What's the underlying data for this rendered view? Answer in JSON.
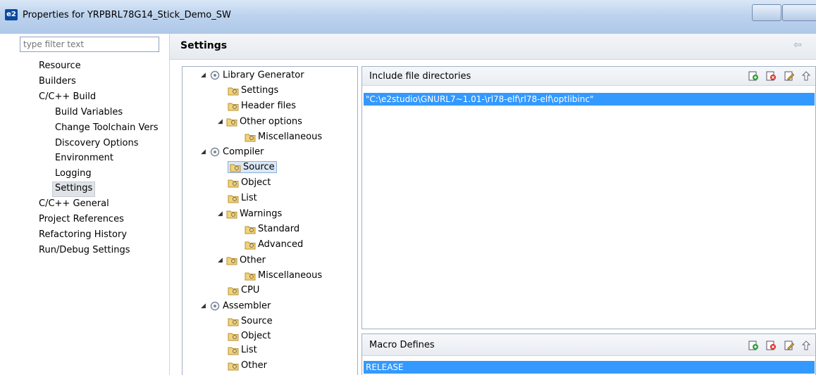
{
  "window": {
    "title": "Properties for YRPBRL78G14_Stick_Demo_SW",
    "app_icon": "e2"
  },
  "filter": {
    "placeholder": "type filter text"
  },
  "nav": {
    "items": [
      {
        "label": "Resource"
      },
      {
        "label": "Builders"
      },
      {
        "label": "C/C++ Build"
      },
      {
        "label": "Build Variables"
      },
      {
        "label": "Change Toolchain Vers"
      },
      {
        "label": "Discovery Options"
      },
      {
        "label": "Environment"
      },
      {
        "label": "Logging"
      },
      {
        "label": "Settings"
      },
      {
        "label": "C/C++ General"
      },
      {
        "label": "Project References"
      },
      {
        "label": "Refactoring History"
      },
      {
        "label": "Run/Debug Settings"
      }
    ],
    "selected": "Settings"
  },
  "header": {
    "title": "Settings",
    "back_icon": "back-arrow-icon"
  },
  "tree": {
    "items": [
      {
        "label": "Library Generator",
        "icon": "tool-icon"
      },
      {
        "label": "Settings",
        "icon": "folder-settings-icon"
      },
      {
        "label": "Header files",
        "icon": "folder-settings-icon"
      },
      {
        "label": "Other options",
        "icon": "folder-settings-icon"
      },
      {
        "label": "Miscellaneous",
        "icon": "folder-settings-icon"
      },
      {
        "label": "Compiler",
        "icon": "tool-icon"
      },
      {
        "label": "Source",
        "icon": "folder-settings-icon"
      },
      {
        "label": "Object",
        "icon": "folder-settings-icon"
      },
      {
        "label": "List",
        "icon": "folder-settings-icon"
      },
      {
        "label": "Warnings",
        "icon": "folder-settings-icon"
      },
      {
        "label": "Standard",
        "icon": "folder-settings-icon"
      },
      {
        "label": "Advanced",
        "icon": "folder-settings-icon"
      },
      {
        "label": "Other",
        "icon": "folder-settings-icon"
      },
      {
        "label": "Miscellaneous",
        "icon": "folder-settings-icon"
      },
      {
        "label": "CPU",
        "icon": "folder-settings-icon"
      },
      {
        "label": "Assembler",
        "icon": "tool-icon"
      },
      {
        "label": "Source",
        "icon": "folder-settings-icon"
      },
      {
        "label": "Object",
        "icon": "folder-settings-icon"
      },
      {
        "label": "List",
        "icon": "folder-settings-icon"
      },
      {
        "label": "Other",
        "icon": "folder-settings-icon"
      }
    ],
    "selected": "Source"
  },
  "include_dirs": {
    "label": "Include file directories",
    "entries": [
      "\"C:\\e2studio\\GNURL7~1.01-\\rl78-elf\\rl78-elf\\optlibinc\""
    ]
  },
  "macro_defines": {
    "label": "Macro Defines",
    "entries": [
      "RELEASE"
    ]
  },
  "toolbar_icons": [
    "add-icon",
    "delete-icon",
    "edit-icon",
    "move-up-icon"
  ],
  "colors": {
    "selection": "#3399ff",
    "tree_selection": "#dbe7f6"
  }
}
